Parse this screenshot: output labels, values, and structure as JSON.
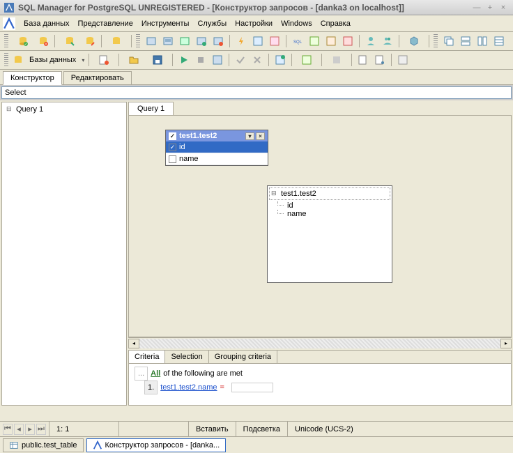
{
  "window": {
    "title": "SQL Manager for PostgreSQL UNREGISTERED - [Конструктор запросов - [danka3 on localhost]]"
  },
  "menu": {
    "database": "База данных",
    "view": "Представление",
    "tools": "Инструменты",
    "services": "Службы",
    "settings": "Настройки",
    "windows": "Windows",
    "help": "Справка"
  },
  "toolbar2": {
    "databases_label": "Базы данных"
  },
  "tabs": {
    "constructor": "Конструктор",
    "edit": "Редактировать"
  },
  "select_label": "Select",
  "tree": {
    "query": "Query 1"
  },
  "right_tab": "Query 1",
  "table_win": {
    "title": "test1.test2",
    "col_id": "id",
    "col_name": "name"
  },
  "popup": {
    "root": "test1.test2",
    "c1": "id",
    "c2": "name"
  },
  "criteria_tabs": {
    "criteria": "Criteria",
    "selection": "Selection",
    "grouping": "Grouping criteria"
  },
  "criteria": {
    "all": "All",
    "text": "of the following are met",
    "num": "1.",
    "field": "test1.test2.name",
    "op": "="
  },
  "status": {
    "pos": "1:   1",
    "mode": "Вставить",
    "highlight": "Подсветка",
    "encoding": "Unicode (UCS-2)"
  },
  "taskbar": {
    "item1": "public.test_table",
    "item2": "Конструктор запросов - [danka..."
  }
}
